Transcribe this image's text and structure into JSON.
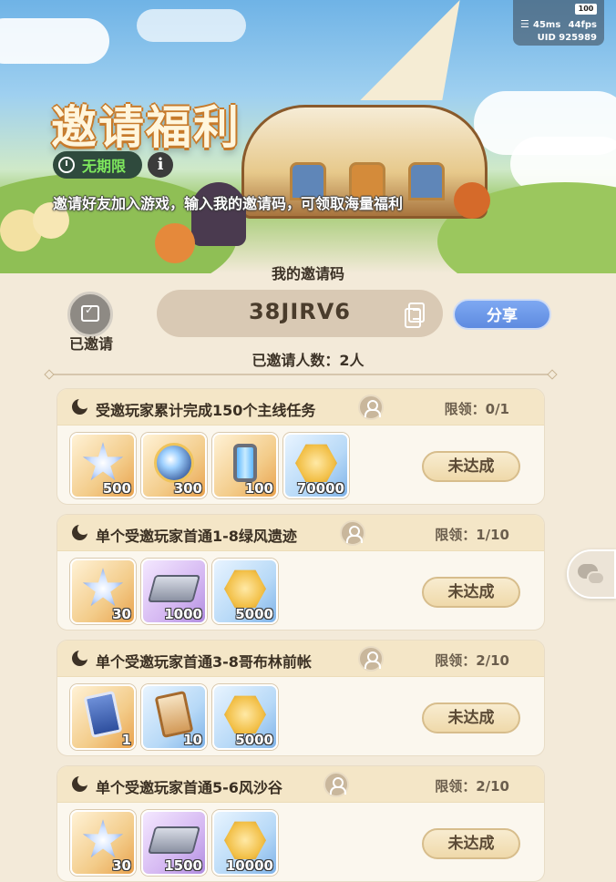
{
  "header": {
    "title": "邀请福利",
    "badge_label": "无期限",
    "info_glyph": "i",
    "subtitle": "邀请好友加入游戏，输入我的邀请码，可领取海量福利"
  },
  "status_bar": {
    "battery": "100",
    "ping": "45ms",
    "fps": "44fps",
    "uid": "UID 925989"
  },
  "invite": {
    "code_label": "我的邀请码",
    "code": "38JIRV6",
    "share_label": "分享",
    "invited_label": "已邀请",
    "count_text": "已邀请人数：2人"
  },
  "tasks": [
    {
      "title": "受邀玩家累计完成150个主线任务",
      "limit": "限领：0/1",
      "status_label": "未达成",
      "rewards": [
        {
          "icon": "star-crystal-icon",
          "rarity": "orange",
          "qty": "500"
        },
        {
          "icon": "magic-orb-icon",
          "rarity": "orange",
          "qty": "300"
        },
        {
          "icon": "energy-cylinder-icon",
          "rarity": "orange",
          "qty": "100"
        },
        {
          "icon": "gold-coin-icon",
          "rarity": "blue",
          "qty": "70000"
        }
      ]
    },
    {
      "title": "单个受邀玩家首通1-8绿风遗迹",
      "limit": "限领：1/10",
      "status_label": "未达成",
      "rewards": [
        {
          "icon": "star-crystal-icon",
          "rarity": "orange",
          "qty": "30"
        },
        {
          "icon": "metal-ingot-icon",
          "rarity": "purple",
          "qty": "1000"
        },
        {
          "icon": "gold-coin-icon",
          "rarity": "blue",
          "qty": "5000"
        }
      ]
    },
    {
      "title": "单个受邀玩家首通3-8哥布林前帐",
      "limit": "限领：2/10",
      "status_label": "未达成",
      "rewards": [
        {
          "icon": "blue-card-icon",
          "rarity": "orange",
          "qty": "1"
        },
        {
          "icon": "gold-card-icon",
          "rarity": "blue",
          "qty": "10"
        },
        {
          "icon": "gold-coin-icon",
          "rarity": "blue",
          "qty": "5000"
        }
      ]
    },
    {
      "title": "单个受邀玩家首通5-6风沙谷",
      "limit": "限领：2/10",
      "status_label": "未达成",
      "rewards": [
        {
          "icon": "star-crystal-icon",
          "rarity": "orange",
          "qty": "30"
        },
        {
          "icon": "metal-ingot-icon",
          "rarity": "purple",
          "qty": "1500"
        },
        {
          "icon": "gold-coin-icon",
          "rarity": "blue",
          "qty": "10000"
        }
      ]
    }
  ],
  "colors": {
    "background": "#f3ead9",
    "share_button": "#6b95e8",
    "badge_text": "#7ee85d",
    "card_header": "#f4e6c7"
  }
}
